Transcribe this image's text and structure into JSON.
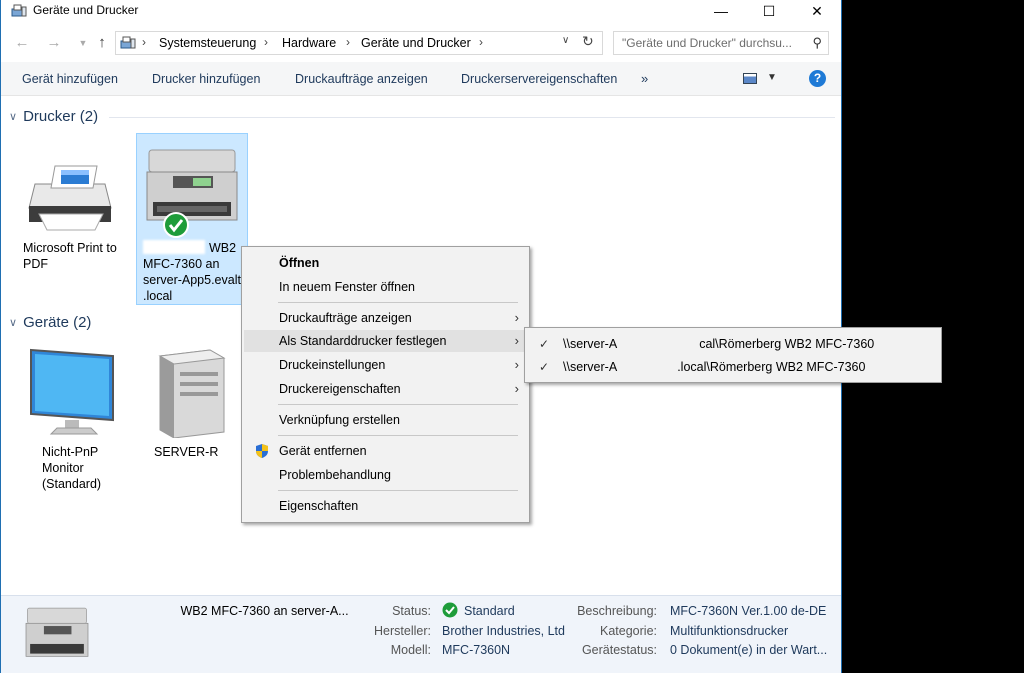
{
  "window": {
    "title": "Geräte und Drucker"
  },
  "address": {
    "crumbs": [
      "Systemsteuerung",
      "Hardware",
      "Geräte und Drucker"
    ],
    "search_placeholder": "\"Geräte und Drucker\" durchsu..."
  },
  "toolbar": {
    "items": [
      "Gerät hinzufügen",
      "Drucker hinzufügen",
      "Druckaufträge anzeigen",
      "Druckerservereigenschaften"
    ],
    "more": "»",
    "help": "?"
  },
  "groups": {
    "printers": {
      "header": "Drucker (2)",
      "items": [
        {
          "label": "Microsoft Print to\nPDF"
        },
        {
          "label": "WB2\nMFC-7360 an\nserver-App5.evalt\n.local"
        }
      ]
    },
    "devices": {
      "header": "Geräte (2)",
      "items": [
        {
          "label": "Nicht-PnP\nMonitor\n(Standard)"
        },
        {
          "label": "SERVER-R"
        }
      ]
    }
  },
  "context_menu": {
    "items": [
      {
        "label": "Öffnen"
      },
      {
        "label": "In neuem Fenster öffnen"
      },
      {
        "label": "Druckaufträge anzeigen"
      },
      {
        "label": "Als Standarddrucker festlegen"
      },
      {
        "label": "Druckeinstellungen"
      },
      {
        "label": "Druckereigenschaften"
      },
      {
        "label": "Verknüpfung erstellen"
      },
      {
        "label": "Gerät entfernen"
      },
      {
        "label": "Problembehandlung"
      },
      {
        "label": "Eigenschaften"
      }
    ]
  },
  "submenu": {
    "items": [
      {
        "prefix": "\\\\server-A",
        "suffix": "cal\\Römerberg WB2 MFC-7360"
      },
      {
        "prefix": "\\\\server-A",
        "suffix": ".local\\Römerberg WB2 MFC-7360"
      }
    ]
  },
  "details": {
    "name": "WB2 MFC-7360 an server-A...",
    "status_label": "Status:",
    "status_value": "Standard",
    "manufacturer_label": "Hersteller:",
    "manufacturer_value": "Brother Industries, Ltd",
    "model_label": "Modell:",
    "model_value": "MFC-7360N",
    "description_label": "Beschreibung:",
    "description_value": "MFC-7360N Ver.1.00 de-DE",
    "category_label": "Kategorie:",
    "category_value": "Multifunktionsdrucker",
    "device_status_label": "Gerätestatus:",
    "device_status_value": "0 Dokument(e) in der Wart..."
  }
}
